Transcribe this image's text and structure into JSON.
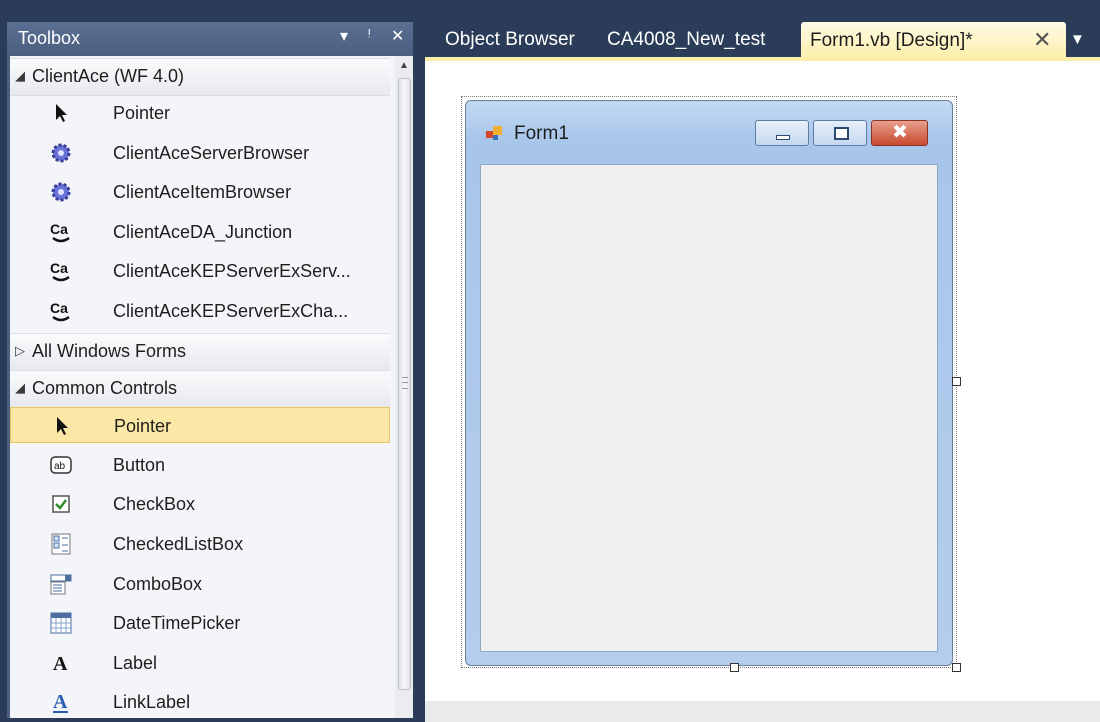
{
  "toolbox": {
    "title": "Toolbox",
    "pin_glyph": "↓  Ѱ",
    "close_glyph": "✕",
    "groups": [
      {
        "label": "ClientAce (WF 4.0)",
        "expanded": true
      },
      {
        "label": "All Windows Forms",
        "expanded": false
      },
      {
        "label": "Common Controls",
        "expanded": true
      }
    ],
    "clientace_items": [
      {
        "label": "Pointer",
        "icon": "pointer-arrow-icon"
      },
      {
        "label": "ClientAceServerBrowser",
        "icon": "gear-component-icon"
      },
      {
        "label": "ClientAceItemBrowser",
        "icon": "gear-component-icon"
      },
      {
        "label": "ClientAceDA_Junction",
        "icon": "clientace-ca-icon"
      },
      {
        "label": "ClientAceKEPServerExServ...",
        "icon": "clientace-ca-icon"
      },
      {
        "label": "ClientAceKEPServerExCha...",
        "icon": "clientace-ca-icon"
      }
    ],
    "common_items": [
      {
        "label": "Pointer",
        "icon": "pointer-arrow-icon",
        "selected": true
      },
      {
        "label": "Button",
        "icon": "button-ab-icon"
      },
      {
        "label": "CheckBox",
        "icon": "checkbox-icon"
      },
      {
        "label": "CheckedListBox",
        "icon": "checkedlistbox-icon"
      },
      {
        "label": "ComboBox",
        "icon": "combobox-icon"
      },
      {
        "label": "DateTimePicker",
        "icon": "datetimepicker-icon"
      },
      {
        "label": "Label",
        "icon": "label-a-icon"
      },
      {
        "label": "LinkLabel",
        "icon": "linklabel-a-icon"
      }
    ]
  },
  "tabs": {
    "items": [
      "Object Browser",
      "CA4008_New_test"
    ],
    "active": "Form1.vb [Design]*",
    "close_glyph": "✕",
    "dropdown_glyph": "▼"
  },
  "form": {
    "title": "Form1",
    "close_glyph": "✖"
  },
  "colors": {
    "chrome": "#2b3c59",
    "selection": "#fbe8a6",
    "active_tab": "#fdeea8"
  }
}
